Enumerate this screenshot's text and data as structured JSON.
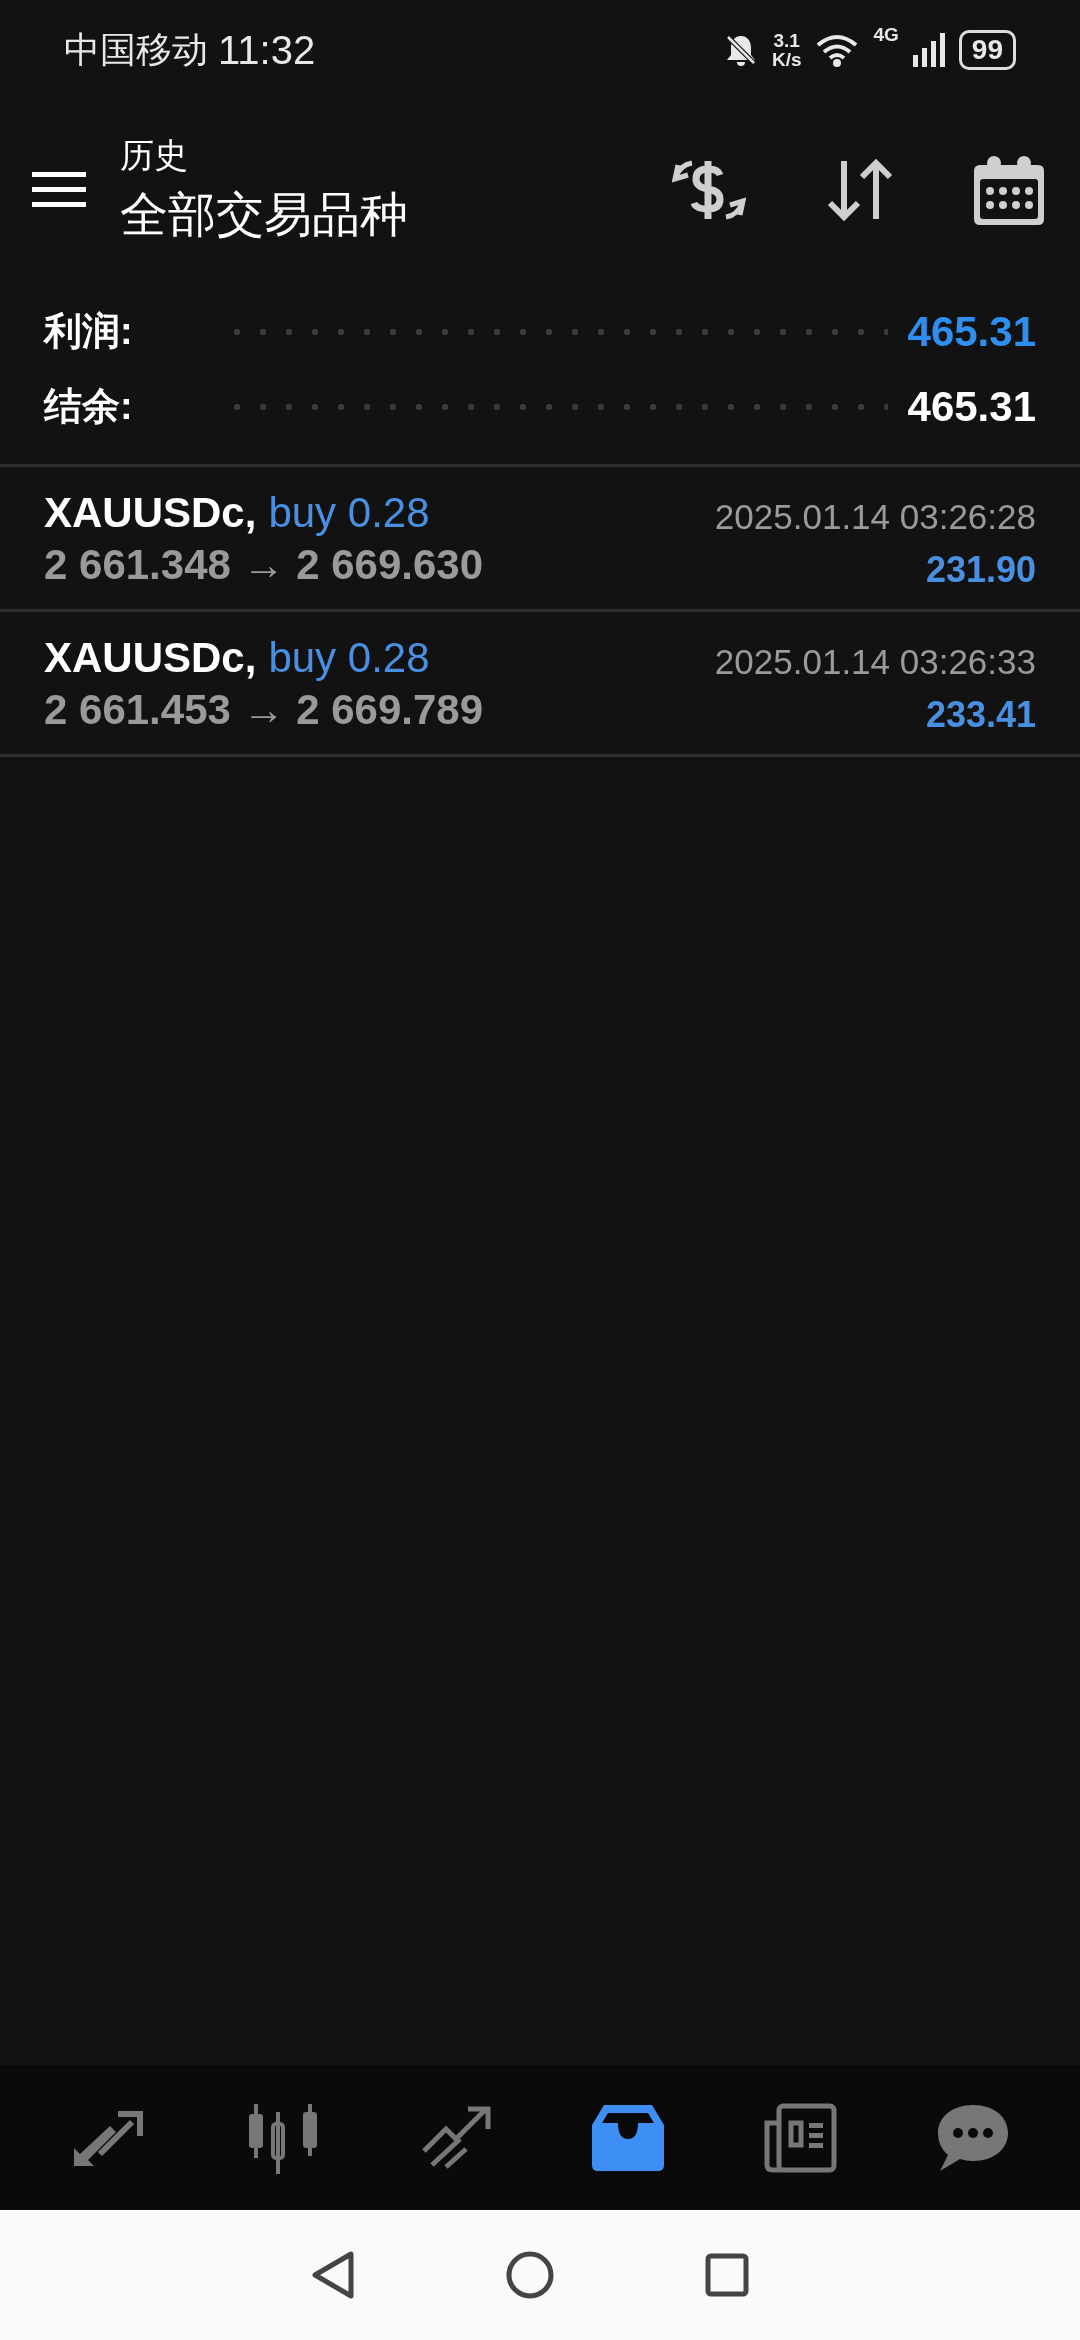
{
  "status_bar": {
    "carrier": "中国移动",
    "time": "11:32",
    "speed_value": "3.1",
    "speed_unit": "K/s",
    "network": "4G",
    "battery": "99"
  },
  "header": {
    "subtitle": "历史",
    "title": "全部交易品种"
  },
  "summary": [
    {
      "label": "利润:",
      "value": "465.31",
      "color": "#2f8ff0"
    },
    {
      "label": "结余:",
      "value": "465.31",
      "color": "#ffffff"
    }
  ],
  "trades": [
    {
      "symbol": "XAUUSDc,",
      "order": "buy 0.28",
      "prices": "2 661.348 → 2 669.630",
      "time": "2025.01.14 03:26:28",
      "profit": "231.90"
    },
    {
      "symbol": "XAUUSDc,",
      "order": "buy 0.28",
      "prices": "2 661.453 → 2 669.789",
      "time": "2025.01.14 03:26:33",
      "profit": "233.41"
    }
  ],
  "bottom_nav": [
    {
      "kind": "trade",
      "selected": false
    },
    {
      "kind": "chart",
      "selected": false
    },
    {
      "kind": "trend",
      "selected": false
    },
    {
      "kind": "history",
      "selected": true
    },
    {
      "kind": "news",
      "selected": false
    },
    {
      "kind": "chat",
      "selected": false
    }
  ]
}
